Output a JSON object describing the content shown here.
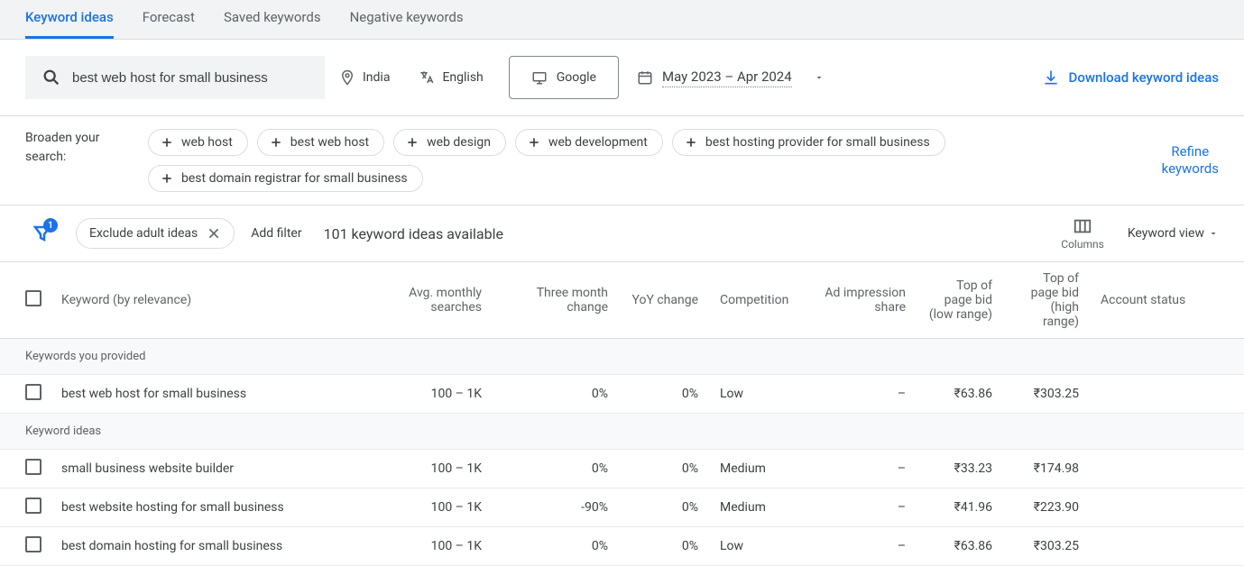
{
  "tabs": {
    "keyword_ideas": "Keyword ideas",
    "forecast": "Forecast",
    "saved_keywords": "Saved keywords",
    "negative_keywords": "Negative keywords"
  },
  "filters": {
    "search_value": "best web host for small business",
    "location": "India",
    "language": "English",
    "network": "Google",
    "date_range": "May 2023 – Apr 2024",
    "download_label": "Download keyword ideas"
  },
  "broaden": {
    "label_line1": "Broaden your",
    "label_line2": "search:",
    "chips": [
      "web host",
      "best web host",
      "web design",
      "web development",
      "best hosting provider for small business",
      "best domain registrar for small business"
    ],
    "refine_line1": "Refine",
    "refine_line2": "keywords"
  },
  "controls": {
    "filter_badge": "1",
    "exclude_label": "Exclude adult ideas",
    "add_filter": "Add filter",
    "ideas_text": "101 keyword ideas available",
    "columns_label": "Columns",
    "keyword_view": "Keyword view"
  },
  "headers": {
    "keyword": "Keyword (by relevance)",
    "avg_searches": "Avg. monthly searches",
    "three_month": "Three month change",
    "yoy": "YoY change",
    "competition": "Competition",
    "ad_impression": "Ad impression share",
    "bid_low": "Top of page bid (low range)",
    "bid_high": "Top of page bid (high range)",
    "account_status": "Account status"
  },
  "sections": {
    "provided": "Keywords you provided",
    "ideas": "Keyword ideas"
  },
  "rows": {
    "provided": [
      {
        "keyword": "best web host for small business",
        "avg": "100 – 1K",
        "three_month": "0%",
        "yoy": "0%",
        "competition": "Low",
        "ad_imp": "–",
        "bid_low": "₹63.86",
        "bid_high": "₹303.25",
        "account": ""
      }
    ],
    "ideas": [
      {
        "keyword": "small business website builder",
        "avg": "100 – 1K",
        "three_month": "0%",
        "yoy": "0%",
        "competition": "Medium",
        "ad_imp": "–",
        "bid_low": "₹33.23",
        "bid_high": "₹174.98",
        "account": ""
      },
      {
        "keyword": "best website hosting for small business",
        "avg": "100 – 1K",
        "three_month": "-90%",
        "yoy": "0%",
        "competition": "Medium",
        "ad_imp": "–",
        "bid_low": "₹41.96",
        "bid_high": "₹223.90",
        "account": ""
      },
      {
        "keyword": "best domain hosting for small business",
        "avg": "100 – 1K",
        "three_month": "0%",
        "yoy": "0%",
        "competition": "Low",
        "ad_imp": "–",
        "bid_low": "₹63.86",
        "bid_high": "₹303.25",
        "account": ""
      }
    ]
  }
}
